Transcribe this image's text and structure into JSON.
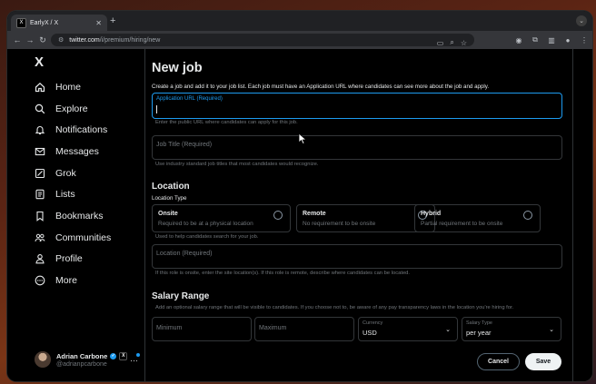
{
  "browser": {
    "tab_title": "EarlyX / X",
    "tab_favicon": "X",
    "new_tab": "+",
    "url_host": "twitter.com",
    "url_path": "/i/premium/hiring/new"
  },
  "sidebar": {
    "logo": "X",
    "items": [
      {
        "label": "Home",
        "icon": "home-icon"
      },
      {
        "label": "Explore",
        "icon": "search-icon"
      },
      {
        "label": "Notifications",
        "icon": "bell-icon"
      },
      {
        "label": "Messages",
        "icon": "mail-icon"
      },
      {
        "label": "Grok",
        "icon": "grok-icon"
      },
      {
        "label": "Lists",
        "icon": "list-icon"
      },
      {
        "label": "Bookmarks",
        "icon": "bookmark-icon"
      },
      {
        "label": "Communities",
        "icon": "people-icon"
      },
      {
        "label": "Profile",
        "icon": "person-icon"
      },
      {
        "label": "More",
        "icon": "more-circle-icon"
      }
    ],
    "profile": {
      "name": "Adrian Carbone",
      "handle": "@adrianpcarbone",
      "more": "···"
    }
  },
  "form": {
    "title": "New job",
    "intro": "Create a job and add it to your job list. Each job must have an Application URL where candidates can see more about the job and apply.",
    "application_url": {
      "label": "Application URL (Required)",
      "help": "Enter the public URL where candidates can apply for this job."
    },
    "job_title": {
      "label": "Job Title (Required)",
      "help": "Use industry standard job titles that most candidates would recognize."
    },
    "location": {
      "heading": "Location",
      "type_label": "Location Type",
      "options": [
        {
          "title": "Onsite",
          "desc": "Required to be at a physical location"
        },
        {
          "title": "Remote",
          "desc": "No requirement to be onsite"
        },
        {
          "title": "Hybrid",
          "desc": "Partial requirement to be onsite"
        }
      ],
      "type_help": "Used to help candidates search for your job.",
      "field_label": "Location (Required)",
      "field_help": "If this role is onsite, enter the site location(s). If this role is remote, describe where candidates can be located."
    },
    "salary": {
      "heading": "Salary Range",
      "help": "Add an optional salary range that will be visible to candidates. If you choose not to, be aware of any pay transparency laws in the location you're hiring for.",
      "minimum": "Minimum",
      "maximum": "Maximum",
      "currency_label": "Currency",
      "currency_value": "USD",
      "type_label": "Salary Type",
      "type_value": "per year"
    },
    "cancel": "Cancel",
    "save": "Save"
  }
}
